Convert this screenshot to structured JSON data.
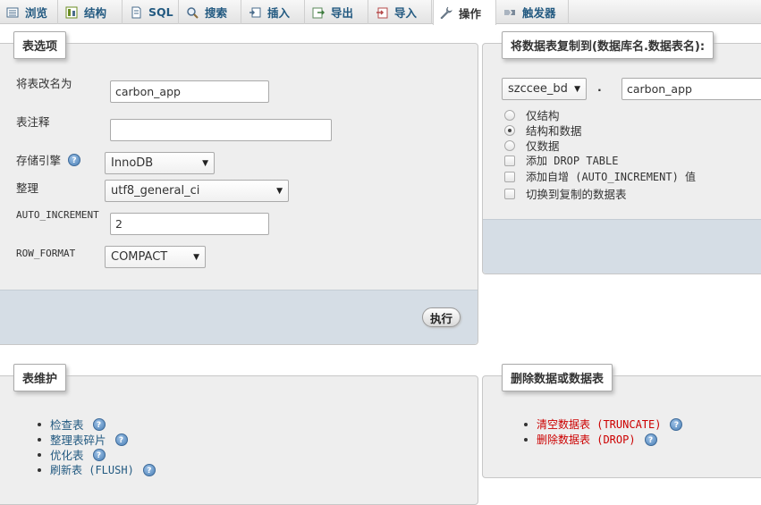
{
  "tabs": [
    {
      "label": "浏览",
      "icon": "browse-icon"
    },
    {
      "label": "结构",
      "icon": "structure-icon"
    },
    {
      "label": "SQL",
      "icon": "sql-icon"
    },
    {
      "label": "搜索",
      "icon": "search-icon"
    },
    {
      "label": "插入",
      "icon": "insert-icon"
    },
    {
      "label": "导出",
      "icon": "export-icon"
    },
    {
      "label": "导入",
      "icon": "import-icon"
    },
    {
      "label": "操作",
      "icon": "wrench-icon",
      "active": true
    },
    {
      "label": "触发器",
      "icon": "triggers-icon"
    }
  ],
  "table_options": {
    "legend": "表选项",
    "rename_label": "将表改名为",
    "rename_value": "carbon_app",
    "comment_label": "表注释",
    "comment_value": "",
    "engine_label": "存储引擎",
    "engine_value": "InnoDB",
    "collation_label": "整理",
    "collation_value": "utf8_general_ci",
    "auto_increment_label": "AUTO_INCREMENT",
    "auto_increment_value": "2",
    "row_format_label": "ROW_FORMAT",
    "row_format_value": "COMPACT",
    "execute_label": "执行"
  },
  "copy_table": {
    "legend": "将数据表复制到(数据库名.数据表名):",
    "database_value": "szccee_bd",
    "dot": ".",
    "table_value": "carbon_app",
    "options": [
      {
        "label": "仅结构",
        "type": "radio",
        "checked": false
      },
      {
        "label": "结构和数据",
        "type": "radio",
        "checked": true
      },
      {
        "label": "仅数据",
        "type": "radio",
        "checked": false
      },
      {
        "label": "添加 DROP TABLE",
        "type": "checkbox",
        "checked": false
      },
      {
        "label": "添加自增 (AUTO_INCREMENT) 值",
        "type": "checkbox",
        "checked": false
      },
      {
        "label": "切换到复制的数据表",
        "type": "checkbox",
        "checked": false
      }
    ]
  },
  "maintenance": {
    "legend": "表维护",
    "items": [
      "检查表",
      "整理表碎片",
      "优化表",
      "刷新表 (FLUSH)"
    ]
  },
  "delete": {
    "legend": "删除数据或数据表",
    "items": [
      "清空数据表 (TRUNCATE)",
      "删除数据表 (DROP)"
    ]
  },
  "colors": {
    "link": "#235a81",
    "danger": "#cc0000",
    "panel_bg": "#eeeeee",
    "footer_bg": "#d5dde5"
  }
}
